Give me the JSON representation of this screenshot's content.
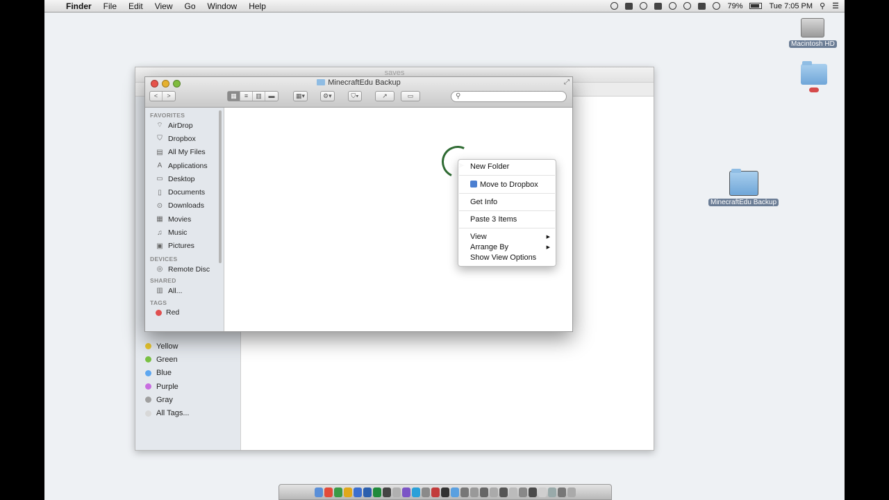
{
  "menubar": {
    "apple": "",
    "app": "Finder",
    "menus": [
      "File",
      "Edit",
      "View",
      "Go",
      "Window",
      "Help"
    ],
    "battery": "79%",
    "clock": "Tue 7:05 PM"
  },
  "desktop": {
    "drive_label": "Macintosh HD",
    "folder_label": "MinecraftEdu Backup"
  },
  "back_window": {
    "title": "saves",
    "tags": [
      {
        "label": "Yellow",
        "color": "#e6c42e"
      },
      {
        "label": "Green",
        "color": "#7ac143"
      },
      {
        "label": "Blue",
        "color": "#5ea7f0"
      },
      {
        "label": "Purple",
        "color": "#c86ee0"
      },
      {
        "label": "Gray",
        "color": "#a0a0a0"
      },
      {
        "label": "All Tags...",
        "color": "#d8d8d8"
      }
    ]
  },
  "front_window": {
    "title": "MinecraftEdu Backup",
    "nav": [
      "<",
      ">"
    ],
    "sections": {
      "favorites": "FAVORITES",
      "devices": "DEVICES",
      "shared": "SHARED",
      "tags": "TAGS"
    },
    "favorites": [
      {
        "label": "AirDrop",
        "icon": "airdrop-icon",
        "glyph": "⌔"
      },
      {
        "label": "Dropbox",
        "icon": "dropbox-icon",
        "glyph": "⛉"
      },
      {
        "label": "All My Files",
        "icon": "all-files-icon",
        "glyph": "▤"
      },
      {
        "label": "Applications",
        "icon": "applications-icon",
        "glyph": "A"
      },
      {
        "label": "Desktop",
        "icon": "desktop-icon",
        "glyph": "▭"
      },
      {
        "label": "Documents",
        "icon": "documents-icon",
        "glyph": "▯"
      },
      {
        "label": "Downloads",
        "icon": "downloads-icon",
        "glyph": "⊙"
      },
      {
        "label": "Movies",
        "icon": "movies-icon",
        "glyph": "▦"
      },
      {
        "label": "Music",
        "icon": "music-icon",
        "glyph": "♫"
      },
      {
        "label": "Pictures",
        "icon": "pictures-icon",
        "glyph": "▣"
      }
    ],
    "devices": [
      {
        "label": "Remote Disc",
        "icon": "remote-disc-icon",
        "glyph": "◎"
      }
    ],
    "shared": [
      {
        "label": "All...",
        "icon": "network-icon",
        "glyph": "▥"
      }
    ],
    "tags": [
      {
        "label": "Red",
        "color": "#e05050"
      }
    ]
  },
  "context_menu": {
    "new_folder": "New Folder",
    "move_to_dropbox": "Move to Dropbox",
    "get_info": "Get Info",
    "paste": "Paste 3 Items",
    "view": "View",
    "arrange_by": "Arrange By",
    "show_view_options": "Show View Options",
    "submenu_arrow": "▶"
  }
}
